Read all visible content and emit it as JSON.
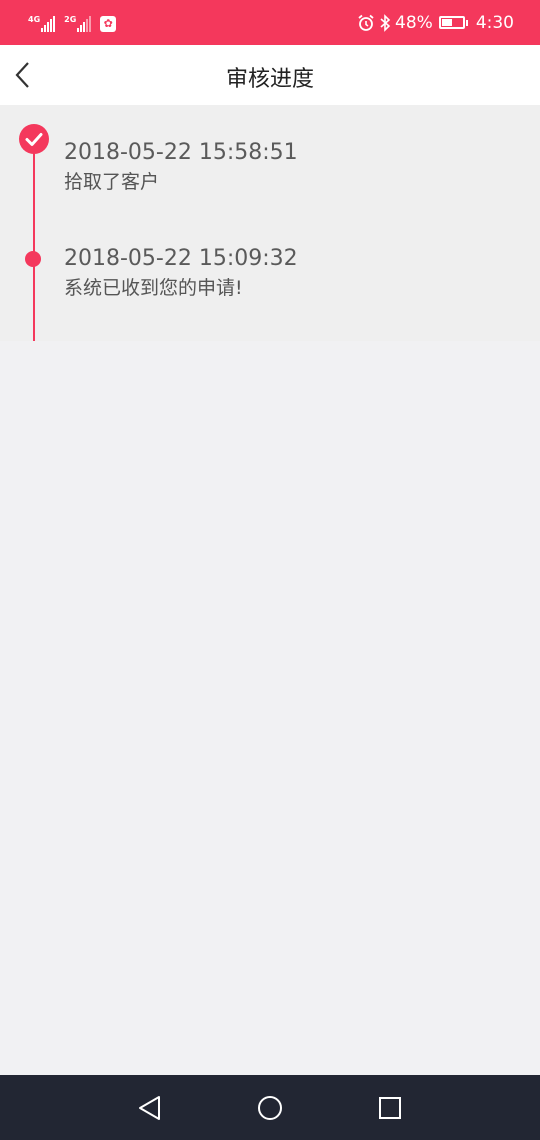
{
  "status_bar": {
    "network1_label": "4G",
    "network2_label": "2G",
    "app_icon_glyph": "✿",
    "battery_percent": "48%",
    "battery_level": 0.48,
    "time": "4:30",
    "icons": [
      "signal-icon",
      "app-notification-icon",
      "alarm-icon",
      "bluetooth-icon",
      "battery-icon"
    ]
  },
  "header": {
    "title": "审核进度",
    "back_icon": "chevron-left-icon"
  },
  "timeline": {
    "items": [
      {
        "time": "2018-05-22 15:58:51",
        "desc": "拾取了客户",
        "marker": "check-circle-icon"
      },
      {
        "time": "2018-05-22 15:09:32",
        "desc": "系统已收到您的申请!",
        "marker": "dot-icon"
      }
    ],
    "accent_color": "#f4385c"
  },
  "system_nav": {
    "buttons": [
      "back-triangle-icon",
      "home-circle-icon",
      "recents-square-icon"
    ]
  },
  "colors": {
    "status_bar": "#f4385c",
    "nav_bar": "#ffffff",
    "background": "#f1f1f3",
    "system_nav": "#222633"
  }
}
